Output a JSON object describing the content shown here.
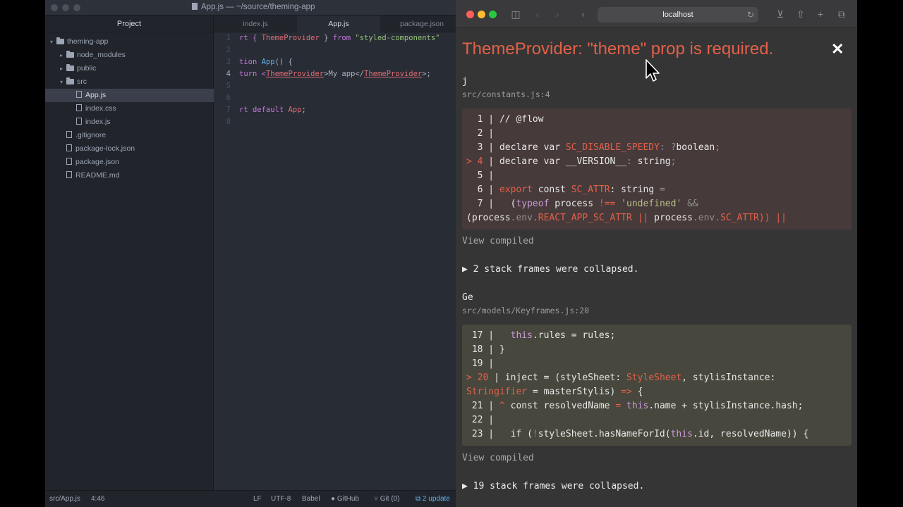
{
  "atom": {
    "title": "App.js — ~/source/theming-app",
    "project_label": "Project",
    "tree": [
      {
        "label": "theming-app",
        "type": "folder",
        "indent": 0,
        "expanded": true
      },
      {
        "label": "node_modules",
        "type": "folder",
        "indent": 1,
        "expanded": false
      },
      {
        "label": "public",
        "type": "folder",
        "indent": 1,
        "expanded": false
      },
      {
        "label": "src",
        "type": "folder",
        "indent": 1,
        "expanded": true
      },
      {
        "label": "App.js",
        "type": "file",
        "indent": 2,
        "selected": true
      },
      {
        "label": "index.css",
        "type": "file",
        "indent": 2
      },
      {
        "label": "index.js",
        "type": "file",
        "indent": 2
      },
      {
        "label": ".gitignore",
        "type": "file",
        "indent": 1
      },
      {
        "label": "package-lock.json",
        "type": "file",
        "indent": 1
      },
      {
        "label": "package.json",
        "type": "file",
        "indent": 1
      },
      {
        "label": "README.md",
        "type": "file",
        "indent": 1
      }
    ],
    "tabs": [
      "index.js",
      "App.js",
      "package.json"
    ],
    "active_tab": "App.js",
    "lines": {
      "n1": "1",
      "n2": "2",
      "n3": "3",
      "n4": "4",
      "n5": "5",
      "n6": "6",
      "n7": "7",
      "n8": "8",
      "l1_a": "rt { ",
      "l1_b": "ThemeProvider",
      "l1_c": " } ",
      "l1_d": "from",
      "l1_e": " \"styled-components\"",
      "l3_a": "tion ",
      "l3_b": "App",
      "l3_c": "() {",
      "l4_a": "turn <",
      "l4_b": "ThemeProvider",
      "l4_c": ">My app</",
      "l4_d": "ThemeProvider",
      "l4_e": ">;",
      "l7_a": "rt default ",
      "l7_b": "App",
      "l7_c": ";"
    },
    "status": {
      "file": "src/App.js",
      "position": "4:46",
      "line_ending": "LF",
      "encoding": "UTF-8",
      "grammar": "Babel",
      "github": "GitHub",
      "git": "Git (0)",
      "updates": "2 update"
    }
  },
  "safari": {
    "url": "localhost",
    "error_title": "ThemeProvider: \"theme\" prop is required.",
    "close_glyph": "✕",
    "frame1": {
      "fn": "j",
      "loc": "src/constants.js:4",
      "c1": "  1 | // @flow",
      "c2": "  2 |",
      "c3a": "  3 | declare var ",
      "c3b": "SC_DISABLE_SPEEDY",
      "c3c": ": ?",
      "c3d": "boolean",
      "c3e": ";",
      "c4a": "> 4",
      "c4b": " | declare var __VERSION__",
      "c4c": ": ",
      "c4d": "string",
      "c4e": ";",
      "c5": "  5 |",
      "c6a": "  6 | ",
      "c6b": "export",
      "c6c": " const ",
      "c6d": "SC_ATTR",
      "c6e": ": string ",
      "c6f": "=",
      "c7a": "  7 |   (",
      "c7b": "typeof",
      "c7c": " process ",
      "c7d": "!==",
      "c7e": " 'undefined'",
      "c7f": " &&",
      "c8a": "(process",
      "c8b": ".env.",
      "c8c": "REACT_APP_SC_ATTR",
      "c8d": " || ",
      "c8e": "process",
      "c8f": ".env.",
      "c8g": "SC_ATTR",
      "c8h": ")) ||",
      "view": "View compiled",
      "collapsed": "▶ 2 stack frames were collapsed."
    },
    "frame2": {
      "fn": "Ge",
      "loc": "src/models/Keyframes.js:20",
      "d1a": " 17 |   ",
      "d1b": "this",
      "d1c": ".rules = rules;",
      "d2": " 18 | }",
      "d3": " 19 |",
      "d4a": "> 20",
      "d4b": " | inject = (styleSheet: ",
      "d4c": "StyleSheet",
      "d4d": ", stylisInstance:",
      "d5a": "Stringifier",
      "d5b": " = masterStylis) ",
      "d5c": "=>",
      "d5d": " {",
      "d6a": " 21 | ",
      "d6b": "^",
      "d6c": " const resolvedName ",
      "d6d": "=",
      "d6e": " this",
      "d6f": ".name + stylisInstance.hash;",
      "d7": " 22 |",
      "d8a": " 23 |   if (",
      "d8b": "!",
      "d8c": "styleSheet.hasNameForId(",
      "d8d": "this",
      "d8e": ".id, resolvedName)) {",
      "view": "View compiled",
      "collapsed": "▶ 19 stack frames were collapsed."
    }
  },
  "colors": {
    "error_red": "#e36049",
    "atom_bg": "#282c34",
    "safari_bg": "#353535"
  },
  "icons": [
    "folder-icon",
    "file-icon",
    "chevron-icon",
    "sidebar-icon",
    "back-icon",
    "forward-icon",
    "shield-icon",
    "reload-icon",
    "download-icon",
    "share-icon",
    "new-tab-icon",
    "tabs-overview-icon",
    "close-icon",
    "cursor-icon",
    "github-icon",
    "git-icon",
    "update-icon"
  ]
}
